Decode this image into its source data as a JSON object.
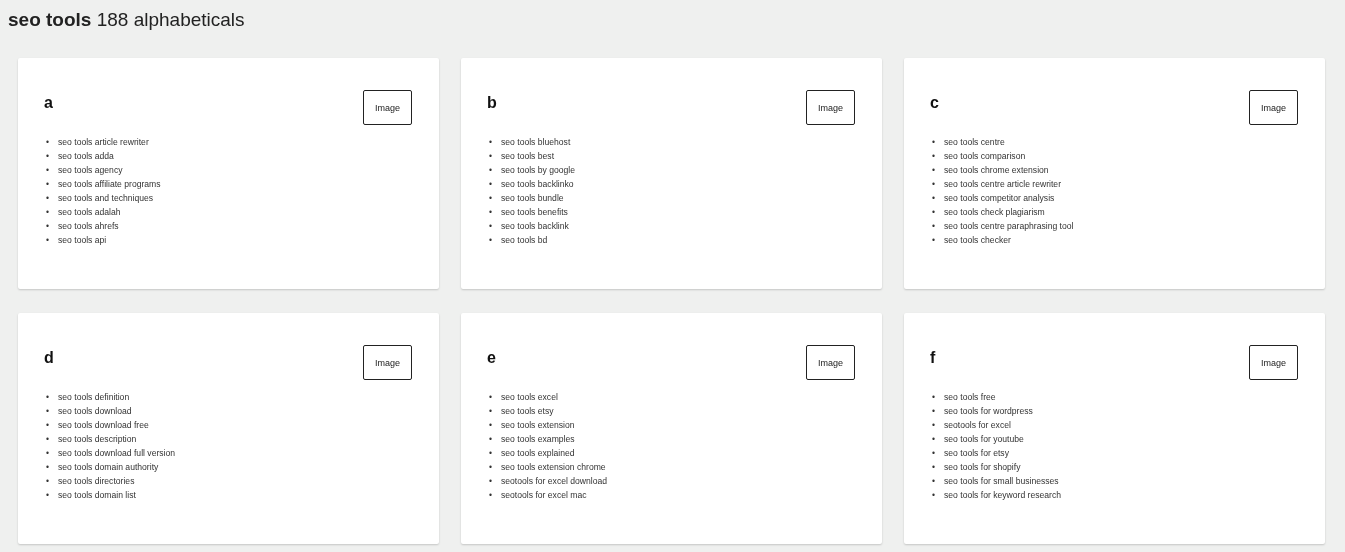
{
  "title": "**seo tools** 188 alphabeticals",
  "bullet": "•",
  "cards": [
    {
      "letter": "a",
      "image_label": "Image",
      "items": [
        "seo tools article rewriter",
        "seo tools adda",
        "seo tools agency",
        "seo tools affiliate programs",
        "seo tools and techniques",
        "seo tools adalah",
        "seo tools ahrefs",
        "seo tools api"
      ]
    },
    {
      "letter": "b",
      "image_label": "Image",
      "items": [
        "seo tools bluehost",
        "seo tools best",
        "seo tools by google",
        "seo tools backlinko",
        "seo tools bundle",
        "seo tools benefits",
        "seo tools backlink",
        "seo tools bd"
      ]
    },
    {
      "letter": "c",
      "image_label": "Image",
      "items": [
        "seo tools centre",
        "seo tools comparison",
        "seo tools chrome extension",
        "seo tools centre article rewriter",
        "seo tools competitor analysis",
        "seo tools check plagiarism",
        "seo tools centre paraphrasing tool",
        "seo tools checker"
      ]
    },
    {
      "letter": "d",
      "image_label": "Image",
      "items": [
        "seo tools definition",
        "seo tools download",
        "seo tools download free",
        "seo tools description",
        "seo tools download full version",
        "seo tools domain authority",
        "seo tools directories",
        "seo tools domain list"
      ]
    },
    {
      "letter": "e",
      "image_label": "Image",
      "items": [
        "seo tools excel",
        "seo tools etsy",
        "seo tools extension",
        "seo tools examples",
        "seo tools explained",
        "seo tools extension chrome",
        "seotools for excel download",
        "seotools for excel mac"
      ]
    },
    {
      "letter": "f",
      "image_label": "Image",
      "items": [
        "seo tools free",
        "seo tools for wordpress",
        "seotools for excel",
        "seo tools for youtube",
        "seo tools for etsy",
        "seo tools for shopify",
        "seo tools for small businesses",
        "seo tools for keyword research"
      ]
    }
  ]
}
